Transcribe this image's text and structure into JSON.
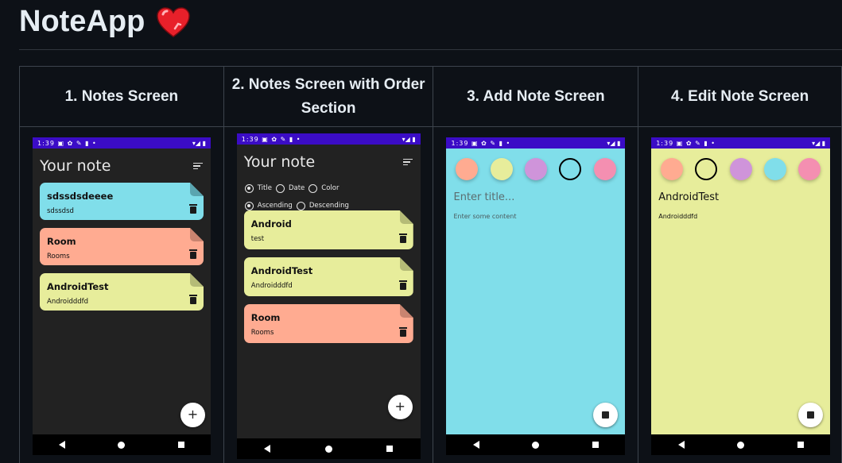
{
  "app": {
    "title": "NoteApp"
  },
  "columns": [
    {
      "header": "1. Notes Screen"
    },
    {
      "header": "2. Notes Screen with Order Section"
    },
    {
      "header": "3. Add Note Screen"
    },
    {
      "header": "4. Edit Note Screen"
    }
  ],
  "status_bar": {
    "time": "1:39",
    "icons": "▣ ✿ ✎ ▮ •",
    "right": "▾◢ ▮"
  },
  "screen1": {
    "heading": "Your note",
    "notes": [
      {
        "title": "sdssdsdeeee",
        "content": "sdssdsd",
        "color": "#80deea"
      },
      {
        "title": "Room",
        "content": "Rooms",
        "color": "#ffab91"
      },
      {
        "title": "AndroidTest",
        "content": "Androidddfd",
        "color": "#e7ed9b"
      }
    ],
    "fab": "+"
  },
  "screen2": {
    "heading": "Your note",
    "order_by": [
      "Title",
      "Date",
      "Color"
    ],
    "order_type": [
      "Ascending",
      "Descending"
    ],
    "selected_order_by": "Title",
    "selected_order_type": "Ascending",
    "notes": [
      {
        "title": "Android",
        "content": "test",
        "color": "#e7ed9b"
      },
      {
        "title": "AndroidTest",
        "content": "Androidddfd",
        "color": "#e7ed9b"
      },
      {
        "title": "Room",
        "content": "Rooms",
        "color": "#ffab91"
      }
    ],
    "fab": "+"
  },
  "screen3": {
    "background": "#80deea",
    "swatches": [
      "#ffab91",
      "#e7ed9b",
      "#cf94da",
      "#80deea",
      "#f48fb1"
    ],
    "selected_swatch_index": 3,
    "title_placeholder": "Enter title...",
    "content_placeholder": "Enter some content"
  },
  "screen4": {
    "background": "#e7ed9b",
    "swatches": [
      "#ffab91",
      "#e7ed9b",
      "#cf94da",
      "#80deea",
      "#f48fb1"
    ],
    "selected_swatch_index": 1,
    "title": "AndroidTest",
    "content": "Androidddfd"
  }
}
